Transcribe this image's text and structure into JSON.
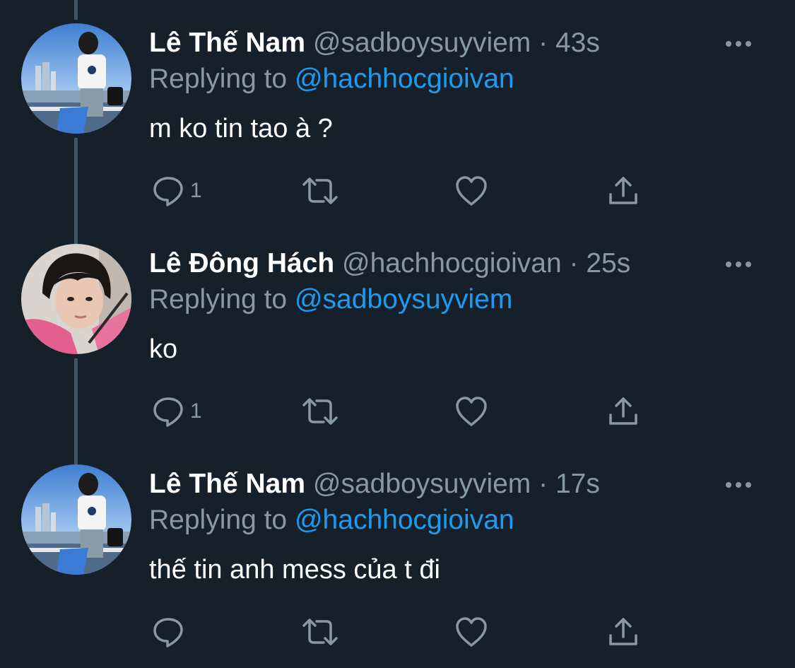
{
  "tweets": [
    {
      "author": "Lê Thế Nam",
      "handle": "@sadboysuyviem",
      "separator": "·",
      "time": "43s",
      "replying_label": "Replying to",
      "replying_to": "@hachhocgioivan",
      "text": "m ko tin tao à ?",
      "reply_count": "1",
      "avatar": "profile-photo-man-white-tshirt-city-waterfront"
    },
    {
      "author": "Lê Đông Hách",
      "handle": "@hachhocgioivan",
      "separator": "·",
      "time": "25s",
      "replying_label": "Replying to",
      "replying_to": "@sadboysuyviem",
      "text": "ko",
      "reply_count": "1",
      "avatar": "profile-photo-young-man-pink-hoodie"
    },
    {
      "author": "Lê Thế Nam",
      "handle": "@sadboysuyviem",
      "separator": "·",
      "time": "17s",
      "replying_label": "Replying to",
      "replying_to": "@hachhocgioivan",
      "text": "thế tin anh mess của t đi",
      "reply_count": "",
      "avatar": "profile-photo-man-white-tshirt-city-waterfront"
    }
  ],
  "icons": {
    "reply": "reply-icon",
    "retweet": "retweet-icon",
    "like": "heart-icon",
    "share": "share-icon",
    "more": "more-options-icon"
  },
  "colors": {
    "background": "#15202b",
    "primary_text": "#ffffff",
    "secondary_text": "#8899a6",
    "accent_link": "#1d9bf0",
    "thread_line": "#3d5466"
  }
}
